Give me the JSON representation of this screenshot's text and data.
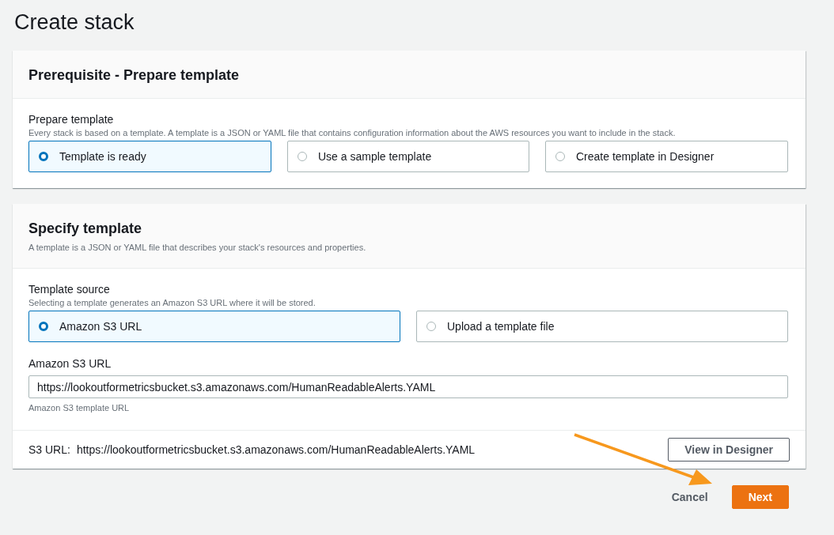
{
  "page_title": "Create stack",
  "prerequisite": {
    "title": "Prerequisite - Prepare template",
    "field_label": "Prepare template",
    "field_description": "Every stack is based on a template. A template is a JSON or YAML file that contains configuration information about the AWS resources you want to include in the stack.",
    "options": [
      {
        "label": "Template is ready",
        "selected": true
      },
      {
        "label": "Use a sample template",
        "selected": false
      },
      {
        "label": "Create template in Designer",
        "selected": false
      }
    ]
  },
  "specify": {
    "title": "Specify template",
    "description": "A template is a JSON or YAML file that describes your stack's resources and properties.",
    "source_label": "Template source",
    "source_description": "Selecting a template generates an Amazon S3 URL where it will be stored.",
    "options": [
      {
        "label": "Amazon S3 URL",
        "selected": true
      },
      {
        "label": "Upload a template file",
        "selected": false
      }
    ],
    "url_label": "Amazon S3 URL",
    "url_value": "https://lookoutformetricsbucket.s3.amazonaws.com/HumanReadableAlerts.YAML",
    "url_hint": "Amazon S3 template URL",
    "s3_label": "S3 URL:",
    "s3_value": "https://lookoutformetricsbucket.s3.amazonaws.com/HumanReadableAlerts.YAML",
    "designer_button": "View in Designer"
  },
  "actions": {
    "cancel": "Cancel",
    "next": "Next"
  }
}
